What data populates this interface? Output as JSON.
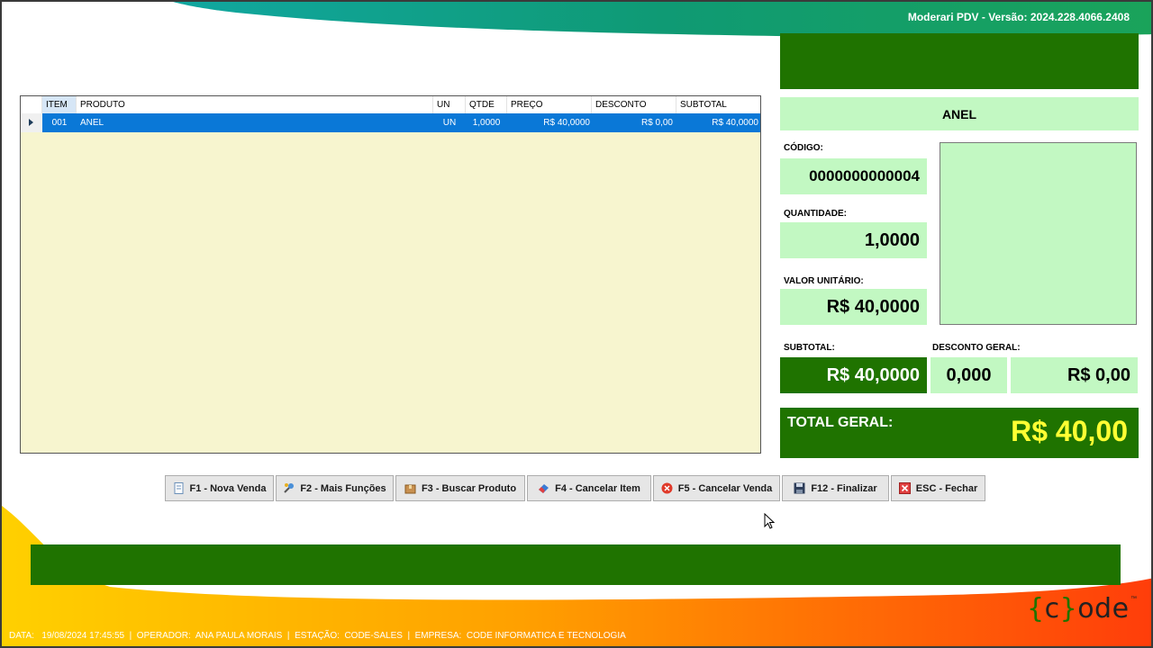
{
  "window": {
    "title": "Moderari PDV - Versão: 2024.228.4066.2408"
  },
  "grid": {
    "columns": [
      "ITEM",
      "PRODUTO",
      "UN",
      "QTDE",
      "PREÇO",
      "DESCONTO",
      "SUBTOTAL"
    ],
    "rows": [
      {
        "item": "001",
        "produto": "ANEL",
        "un": "UN",
        "qtde": "1,0000",
        "preco": "R$ 40,0000",
        "desconto": "R$ 0,00",
        "subtotal": "R$ 40,0000"
      }
    ]
  },
  "product": {
    "name": "ANEL",
    "codigo_label": "CÓDIGO:",
    "codigo": "0000000000004",
    "quantidade_label": "QUANTIDADE:",
    "quantidade": "1,0000",
    "valor_unitario_label": "VALOR UNITÁRIO:",
    "valor_unitario": "R$ 40,0000"
  },
  "totals": {
    "subtotal_label": "SUBTOTAL:",
    "subtotal": "R$ 40,0000",
    "desconto_label": "DESCONTO GERAL:",
    "desconto_percent": "0,000",
    "desconto_valor": "R$ 0,00",
    "total_label": "TOTAL GERAL:",
    "total": "R$ 40,00"
  },
  "actions": [
    {
      "label": "F1 - Nova Venda",
      "icon": "document-icon"
    },
    {
      "label": "F2 - Mais Funções",
      "icon": "tools-icon"
    },
    {
      "label": "F3 - Buscar Produto",
      "icon": "box-icon"
    },
    {
      "label": "F4 - Cancelar Item",
      "icon": "eraser-icon"
    },
    {
      "label": "F5 - Cancelar Venda",
      "icon": "cancel-circle-icon"
    },
    {
      "label": "F12 - Finalizar",
      "icon": "save-icon"
    },
    {
      "label": "ESC - Fechar",
      "icon": "close-icon"
    }
  ],
  "brand": {
    "logo_text": "{c}ode",
    "trademark": "™"
  },
  "status": {
    "data_label": "DATA:",
    "data": "19/08/2024 17:45:55",
    "operador_label": "OPERADOR:",
    "operador": "ANA PAULA MORAIS",
    "estacao_label": "ESTAÇÃO:",
    "estacao": "CODE-SALES",
    "empresa_label": "EMPRESA:",
    "empresa": "CODE INFORMATICA E TECNOLOGIA"
  },
  "colors": {
    "dark_green": "#1f7300",
    "light_green": "#c2f8c2",
    "grid_bg": "#f7f5cf",
    "selection": "#0a78d7",
    "total_yellow": "#ffff33"
  }
}
